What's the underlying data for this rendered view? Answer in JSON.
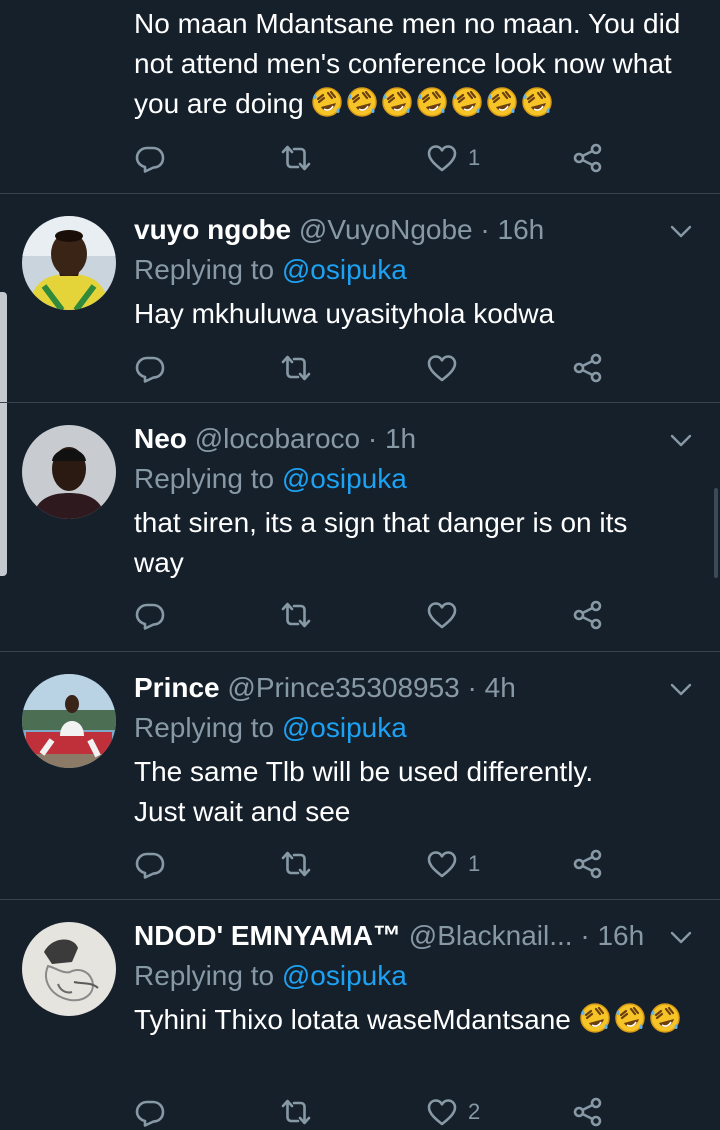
{
  "tweets": [
    {
      "text": "No maan Mdantsane men no maan. You did not attend men's conference look now what you are doing",
      "emoji_count": 7,
      "likes": "1"
    },
    {
      "name": "vuyo ngobe",
      "handle": "@VuyoNgobe",
      "time": "16h",
      "replying_label": "Replying to",
      "replying_to": "@osipuka",
      "text": "Hay mkhuluwa uyasityhola kodwa",
      "likes": ""
    },
    {
      "name": "Neo",
      "handle": "@locobaroco",
      "time": "1h",
      "replying_label": "Replying to",
      "replying_to": "@osipuka",
      "text": "that siren, its a sign that danger is on its way",
      "likes": ""
    },
    {
      "name": "Prince",
      "handle": "@Prince35308953",
      "time": "4h",
      "replying_label": "Replying to",
      "replying_to": "@osipuka",
      "text": "The same Tlb will be used differently. Just wait and see",
      "likes": "1"
    },
    {
      "name": "NDOD' EMNYAMA™",
      "handle": "@Blacknail...",
      "time": "16h",
      "replying_label": "Replying to",
      "replying_to": "@osipuka",
      "text": "Tyhini Thixo lotata waseMdantsane",
      "emoji_count": 3,
      "likes": "2"
    }
  ],
  "separator": "·",
  "icons": {
    "reply": "reply-icon",
    "retweet": "retweet-icon",
    "like": "heart-icon",
    "share": "share-icon",
    "menu": "chevron-down-icon",
    "emoji": "rolling-on-floor-laughing-emoji"
  },
  "colors": {
    "background": "#15202b",
    "divider": "#38444d",
    "secondary_text": "#8899a6",
    "link": "#1da1f2"
  }
}
